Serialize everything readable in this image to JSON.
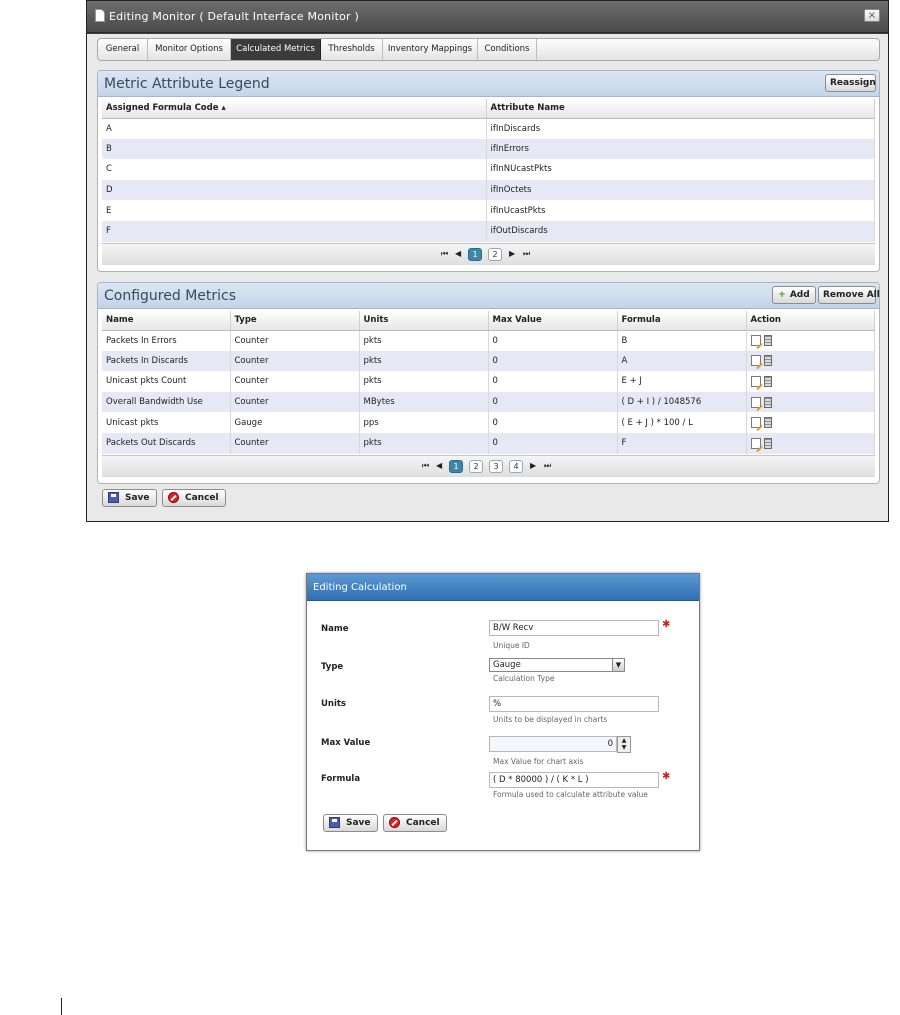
{
  "monitor_window": {
    "title": "Editing Monitor ( Default Interface Monitor )",
    "close_label": "×",
    "tabs": [
      {
        "label": "General"
      },
      {
        "label": "Monitor Options"
      },
      {
        "label": "Calculated Metrics"
      },
      {
        "label": "Thresholds"
      },
      {
        "label": "Inventory Mappings"
      },
      {
        "label": "Conditions"
      }
    ],
    "active_tab": "Calculated Metrics",
    "legend": {
      "title": "Metric Attribute Legend",
      "reassign_label": "Reassign",
      "columns": [
        "Assigned Formula Code ▴",
        "Attribute Name"
      ],
      "rows": [
        [
          "A",
          "ifInDiscards"
        ],
        [
          "B",
          "ifInErrors"
        ],
        [
          "C",
          "ifInNUcastPkts"
        ],
        [
          "D",
          "ifInOctets"
        ],
        [
          "E",
          "ifInUcastPkts"
        ],
        [
          "F",
          "ifOutDiscards"
        ]
      ],
      "pager": {
        "pages": [
          "1",
          "2"
        ],
        "current": "1"
      }
    },
    "metrics": {
      "title": "Configured Metrics",
      "add_label": "Add",
      "remove_all_label": "Remove All",
      "columns": [
        "Name",
        "Type",
        "Units",
        "Max Value",
        "Formula",
        "Action"
      ],
      "rows": [
        [
          "Packets In Errors",
          "Counter",
          "pkts",
          "0",
          "B"
        ],
        [
          "Packets In Discards",
          "Counter",
          "pkts",
          "0",
          "A"
        ],
        [
          "Unicast pkts Count",
          "Counter",
          "pkts",
          "0",
          "E + J"
        ],
        [
          "Overall Bandwidth Use",
          "Counter",
          "MBytes",
          "0",
          "( D + I ) / 1048576"
        ],
        [
          "Unicast pkts",
          "Gauge",
          "pps",
          "0",
          "( E + J ) * 100 / L"
        ],
        [
          "Packets Out Discards",
          "Counter",
          "pkts",
          "0",
          "F"
        ]
      ],
      "pager": {
        "pages": [
          "1",
          "2",
          "3",
          "4"
        ],
        "current": "1"
      }
    },
    "save_label": "Save",
    "cancel_label": "Cancel"
  },
  "calc_window": {
    "title": "Editing Calculation",
    "fields": {
      "name": {
        "label": "Name",
        "value": "B/W Recv",
        "help": "Unique ID"
      },
      "type": {
        "label": "Type",
        "value": "Gauge",
        "help": "Calculation Type"
      },
      "units": {
        "label": "Units",
        "value": "%",
        "help": "Units to be displayed in charts"
      },
      "max_value": {
        "label": "Max Value",
        "value": "0",
        "help": "Max Value for chart axis"
      },
      "formula": {
        "label": "Formula",
        "value": "( D * 80000 ) / ( K * L )",
        "help": "Formula used to calculate attribute value"
      }
    },
    "save_label": "Save",
    "cancel_label": "Cancel"
  }
}
